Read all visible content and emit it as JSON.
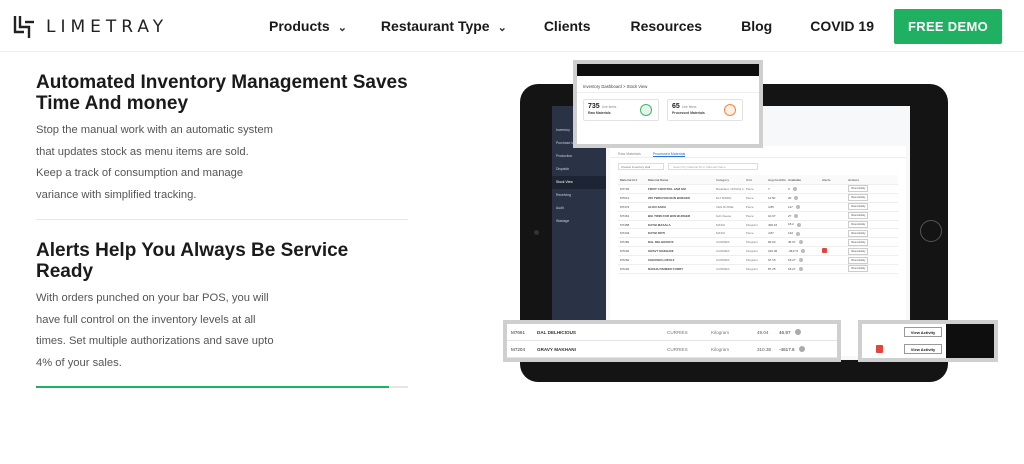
{
  "brand": {
    "name": "LIMETRAY"
  },
  "nav": {
    "items": [
      {
        "label": "Products",
        "dropdown": true
      },
      {
        "label": "Restaurant Type",
        "dropdown": true
      },
      {
        "label": "Clients",
        "dropdown": false
      },
      {
        "label": "Resources",
        "dropdown": false
      },
      {
        "label": "Blog",
        "dropdown": false
      },
      {
        "label": "COVID 19",
        "dropdown": false
      }
    ],
    "cta": "FREE DEMO"
  },
  "sections": [
    {
      "title": "Automated Inventory Management Saves Time And money",
      "body": "Stop the manual work with an automatic system that updates stock as menu items are sold. Keep a track of consumption and manage variance with simplified tracking."
    },
    {
      "title": "Alerts Help You Always Be Service Ready",
      "body": "With orders punched on your bar POS, you will have full control on the inventory levels at all times. Set multiple authorizations and save upto 4% of your sales."
    }
  ],
  "progress": {
    "value": 0.95
  },
  "colors": {
    "accent": "#1fb061",
    "alert": "#e2453c",
    "sidebar": "#2a3345"
  },
  "dashboard": {
    "breadcrumb": "Inventory Dashboard > Stock View",
    "cards": [
      {
        "count": "735",
        "unit": "Line Items",
        "label": "Raw Materials",
        "icon": "leaf-icon",
        "color": "#3fb56a"
      },
      {
        "count": "65",
        "unit": "Line Items",
        "label": "Processed Materials",
        "icon": "flame-icon",
        "color": "#f08a3c"
      }
    ],
    "sidebar": [
      "Inventory",
      "Purchase Mgmt",
      "Production",
      "Dispatch",
      "Stock View",
      "Receiving",
      "Audit",
      "Wastage"
    ],
    "tabs": [
      "Raw Materials",
      "Processed Materials"
    ],
    "filter": "Closest Inventory Hall",
    "search_placeholder": "Search by Material ID or Material Name",
    "table_headers": [
      "Material Id #",
      "Material Name",
      "Category",
      "Unit",
      "Avg Cost/Unit",
      "Available",
      "Alerts",
      "Actions"
    ],
    "rows": [
      {
        "id": "M7702",
        "name": "FRUIT COCKTAIL JAM GM",
        "cat": "Breakfast, CRNCH LCM",
        "unit": "Piece",
        "cost": "7",
        "avail": "0",
        "alert": false
      },
      {
        "id": "M7614",
        "name": "250 TWIN FOR BUN BURGER",
        "cat": "ELT BINDE",
        "unit": "Piece",
        "cost": "11.50",
        "avail": "20",
        "alert": false
      },
      {
        "id": "M7473",
        "name": "ALOO SADA",
        "cat": "VEG RUSSE",
        "unit": "Piece",
        "cost": "4.85",
        "avail": "117",
        "alert": false
      },
      {
        "id": "M7461",
        "name": "BIG TWIN FOR BUN BURGER",
        "cat": "bull cheese",
        "unit": "Piece",
        "cost": "10.37",
        "avail": "27",
        "alert": false
      },
      {
        "id": "M7458",
        "name": "KATHI MASALA",
        "cat": "MATHI",
        "unit": "Kilogram",
        "cost": "400.16",
        "avail": "18.2",
        "alert": false
      },
      {
        "id": "M7443",
        "name": "KATHI ROTI",
        "cat": "MATHI",
        "unit": "Piece",
        "cost": "4.87",
        "avail": "132",
        "alert": false
      },
      {
        "id": "M7482",
        "name": "DAL DELHICIOUS",
        "cat": "CURRIES",
        "unit": "Kilogram",
        "cost": "90.04",
        "avail": "46.97",
        "alert": false
      },
      {
        "id": "M7204",
        "name": "GRAVY MAKHANI",
        "cat": "CURRIES",
        "unit": "Kilogram",
        "cost": "310.36",
        "avail": "-4617.6",
        "alert": true
      },
      {
        "id": "M7262",
        "name": "CHICKEN LOZOLZ",
        "cat": "CURRIES",
        "unit": "Kilogram",
        "cost": "97.15",
        "avail": "18.27",
        "alert": false
      },
      {
        "id": "M7294",
        "name": "RADHA PANEER CURRY",
        "cat": "CURRIES",
        "unit": "Kilogram",
        "cost": "87.25",
        "avail": "18.27",
        "alert": false
      }
    ],
    "action_label": "View Activity"
  },
  "zoom_rows": [
    {
      "id": "M7661",
      "name": "DAL DELHICIOUS",
      "cat": "CURRIES",
      "unit": "Kilogram",
      "cost": "49.04",
      "avail": "46.97",
      "alert": false
    },
    {
      "id": "M7204",
      "name": "GRAVY MAKHANI",
      "cat": "CURRIES",
      "unit": "Kilogram",
      "cost": "310.36",
      "avail": "-4617.6",
      "alert": true
    }
  ]
}
